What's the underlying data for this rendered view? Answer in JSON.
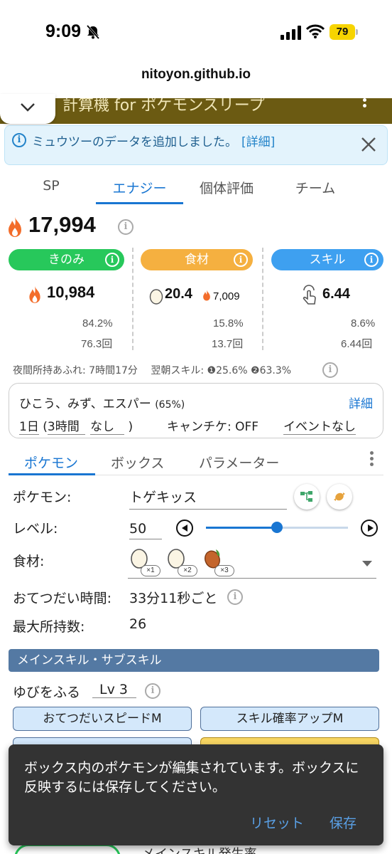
{
  "status": {
    "time": "9:09",
    "battery": "79"
  },
  "url": "nitoyon.github.io",
  "app": {
    "title": "計算機 for ポケモンスリープ"
  },
  "notice": {
    "text": "ミュウツーのデータを追加しました。",
    "link": "[詳細]"
  },
  "main_tabs": [
    "SP",
    "エナジー",
    "個体評価",
    "チーム"
  ],
  "energy": {
    "total": "17,994",
    "categories": [
      {
        "label": "きのみ",
        "color": "#27c85b"
      },
      {
        "label": "食材",
        "color": "#f5b040"
      },
      {
        "label": "スキル",
        "color": "#3ea0f0"
      }
    ],
    "berry": {
      "value": "10,984",
      "percent": "84.2%",
      "count": "76.3回"
    },
    "ingredient": {
      "value": "20.4",
      "energy": "7,009",
      "percent": "15.8%",
      "count": "13.7回"
    },
    "skill": {
      "value": "6.44",
      "percent": "8.6%",
      "count": "6.44回"
    },
    "night": "夜間所持あふれ: 7時間17分",
    "morning_label": "翌朝スキル:",
    "morning_1": "25.6%",
    "morning_2": "63.3%",
    "morning_m1": "❶",
    "morning_m2": "❷"
  },
  "settings": {
    "field": "ひこう、みず、エスパー",
    "field_pct": "(65%)",
    "detail": "詳細",
    "period": "1日",
    "sleep_open": "(",
    "sleep": "3時間",
    "sleep_extra": "なし",
    "sleep_close": ")",
    "candy": "キャンチケ: OFF",
    "event": "イベントなし"
  },
  "sub_tabs": [
    "ポケモン",
    "ボックス",
    "パラメーター"
  ],
  "pokemon": {
    "name_label": "ポケモン:",
    "name": "トゲキッス",
    "level_label": "レベル:",
    "level": "50",
    "level_progress": 0.5,
    "ingredient_label": "食材:",
    "ingredients": [
      {
        "icon": "egg-icon",
        "badge": "×1"
      },
      {
        "icon": "egg-icon",
        "badge": "×2"
      },
      {
        "icon": "cacao-icon",
        "badge": "×3"
      }
    ],
    "help_label": "おてつだい時間:",
    "help_value": "33分11秒ごと",
    "max_label": "最大所持数:",
    "max_value": "26"
  },
  "skill_section": {
    "title": "メインスキル・サブスキル",
    "main_skill": "ゆびをふる",
    "skill_level": "Lv 3",
    "sub1": "おてつだいスピードM",
    "sub2": "スキル確率アップM"
  },
  "snackbar": {
    "message": "ボックス内のポケモンが編集されています。ボックスに反映するには保存してください。",
    "reset": "リセット",
    "save": "保存"
  },
  "bottom_peek": "メインスキル発生率"
}
